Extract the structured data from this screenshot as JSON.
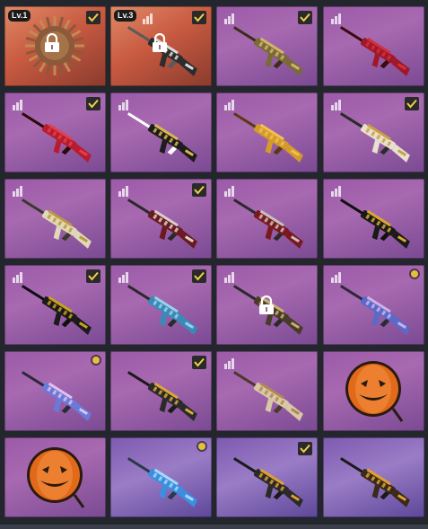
{
  "colors": {
    "check_bg": "#2a2a2a",
    "check_mark": "#f2d04a",
    "equipped_dot": "#e4c13a"
  },
  "tiles": [
    {
      "bg": "orange",
      "badge": "Lv.1",
      "bars": false,
      "check": true,
      "dot": false,
      "lock": true,
      "item": "sticker-brown",
      "colors": [
        "#8a5a3a",
        "#c28a55",
        "#ffffff"
      ]
    },
    {
      "bg": "orange",
      "badge": "Lv.3",
      "bars": true,
      "check": true,
      "dot": false,
      "lock": true,
      "item": "rifle",
      "colors": [
        "#2c2c2c",
        "#dcdcdc",
        "#5a5a5a"
      ]
    },
    {
      "bg": "purple",
      "badge": "",
      "bars": true,
      "check": true,
      "dot": false,
      "lock": false,
      "item": "rifle",
      "colors": [
        "#7a6a3a",
        "#d2b46a",
        "#3a2e1a"
      ]
    },
    {
      "bg": "purple",
      "badge": "",
      "bars": true,
      "check": false,
      "dot": false,
      "lock": false,
      "item": "rifle",
      "colors": [
        "#a01828",
        "#d23040",
        "#3a0a10"
      ]
    },
    {
      "bg": "purple",
      "badge": "",
      "bars": true,
      "check": true,
      "dot": false,
      "lock": false,
      "item": "rifle",
      "colors": [
        "#b81c2c",
        "#e04050",
        "#2a0a0a"
      ]
    },
    {
      "bg": "purple",
      "badge": "",
      "bars": true,
      "check": false,
      "dot": false,
      "lock": false,
      "item": "rifle",
      "colors": [
        "#1c1c1c",
        "#d8b850",
        "#ffffff"
      ]
    },
    {
      "bg": "purple",
      "badge": "",
      "bars": true,
      "check": false,
      "dot": false,
      "lock": false,
      "item": "rifle",
      "colors": [
        "#d49a2a",
        "#f0c050",
        "#5a3a10"
      ]
    },
    {
      "bg": "purple",
      "badge": "",
      "bars": true,
      "check": true,
      "dot": false,
      "lock": false,
      "item": "rifle",
      "colors": [
        "#e8e0d0",
        "#caa040",
        "#2a2a2a"
      ]
    },
    {
      "bg": "purple",
      "badge": "",
      "bars": true,
      "check": false,
      "dot": false,
      "lock": false,
      "item": "rifle",
      "colors": [
        "#e0d8b8",
        "#b89a40",
        "#3a3a2a"
      ]
    },
    {
      "bg": "purple",
      "badge": "",
      "bars": true,
      "check": true,
      "dot": false,
      "lock": false,
      "item": "rifle",
      "colors": [
        "#6a1a20",
        "#d8d0c8",
        "#2a2a2a"
      ]
    },
    {
      "bg": "purple",
      "badge": "",
      "bars": true,
      "check": false,
      "dot": false,
      "lock": false,
      "item": "rifle",
      "colors": [
        "#7a1820",
        "#c8c0b8",
        "#2a2a2a"
      ]
    },
    {
      "bg": "purple",
      "badge": "",
      "bars": true,
      "check": false,
      "dot": false,
      "lock": false,
      "item": "rifle",
      "colors": [
        "#1a1a1a",
        "#d8a830",
        "#101010"
      ]
    },
    {
      "bg": "purple",
      "badge": "",
      "bars": true,
      "check": true,
      "dot": false,
      "lock": false,
      "item": "rifle",
      "colors": [
        "#1a1a1a",
        "#c8a020",
        "#0e0e0e"
      ]
    },
    {
      "bg": "purple",
      "badge": "",
      "bars": true,
      "check": true,
      "dot": false,
      "lock": false,
      "item": "rifle",
      "colors": [
        "#3a8ab8",
        "#9ad0ea",
        "#2a2a2a"
      ]
    },
    {
      "bg": "purple",
      "badge": "",
      "bars": true,
      "check": false,
      "dot": false,
      "lock": true,
      "item": "rifle",
      "colors": [
        "#4a3a2a",
        "#c8b070",
        "#2a2a2a"
      ]
    },
    {
      "bg": "purple",
      "badge": "",
      "bars": true,
      "check": false,
      "dot": true,
      "lock": false,
      "item": "rifle",
      "colors": [
        "#5a6ac8",
        "#d0b0e8",
        "#2a2a3a"
      ]
    },
    {
      "bg": "purple",
      "badge": "",
      "bars": false,
      "check": false,
      "dot": true,
      "lock": false,
      "item": "rifle",
      "colors": [
        "#6a7ad8",
        "#e0c0f0",
        "#2a2a3a"
      ]
    },
    {
      "bg": "purple",
      "badge": "",
      "bars": false,
      "check": true,
      "dot": false,
      "lock": false,
      "item": "rifle",
      "colors": [
        "#2a2a2a",
        "#d8a838",
        "#1a1a1a"
      ]
    },
    {
      "bg": "purple",
      "badge": "",
      "bars": true,
      "check": false,
      "dot": false,
      "lock": false,
      "item": "rifle",
      "colors": [
        "#d8c8a8",
        "#b08850",
        "#4a3a2a"
      ]
    },
    {
      "bg": "purple",
      "badge": "",
      "bars": false,
      "check": false,
      "dot": false,
      "lock": false,
      "item": "sticker-pumpkin",
      "colors": [
        "#e06a1a",
        "#f49040",
        "#2a1a10"
      ]
    },
    {
      "bg": "purple",
      "badge": "",
      "bars": false,
      "check": false,
      "dot": false,
      "lock": false,
      "item": "sticker-pumpkin",
      "colors": [
        "#e06a1a",
        "#f49040",
        "#2a1a10"
      ]
    },
    {
      "bg": "purple2",
      "badge": "",
      "bars": false,
      "check": false,
      "dot": true,
      "lock": false,
      "item": "rifle",
      "colors": [
        "#3a90e0",
        "#a8d8f8",
        "#2a3a4a"
      ]
    },
    {
      "bg": "purple2",
      "badge": "",
      "bars": false,
      "check": true,
      "dot": false,
      "lock": false,
      "item": "rifle",
      "colors": [
        "#2a2a2a",
        "#e0a030",
        "#1a1a1a"
      ]
    },
    {
      "bg": "purple2",
      "badge": "",
      "bars": false,
      "check": false,
      "dot": false,
      "lock": false,
      "item": "rifle",
      "colors": [
        "#3a2a1a",
        "#e0a030",
        "#1a1a1a"
      ]
    }
  ]
}
